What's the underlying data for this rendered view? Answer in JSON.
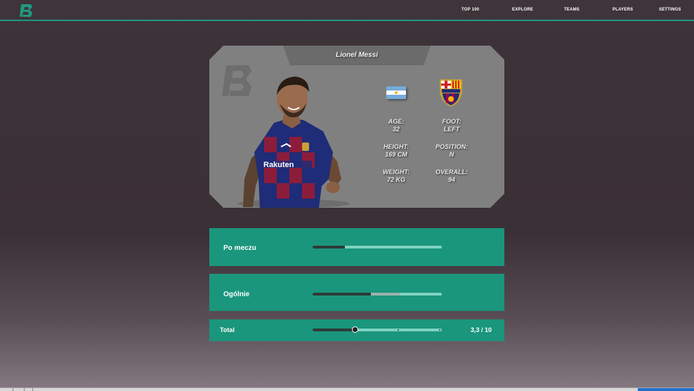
{
  "nav": {
    "items": [
      "TOP 100",
      "EXPLORE",
      "TEAMS",
      "PLAYERS",
      "SETTINGS"
    ]
  },
  "player": {
    "name": "Lionel Messi",
    "nationality_flag": "argentina-flag-icon",
    "club_crest": "fc-barcelona-crest-icon",
    "stats": {
      "age_label": "AGE:",
      "age_value": "32",
      "foot_label": "FOOT:",
      "foot_value": "LEFT",
      "height_label": "HEIGHT:",
      "height_value": "169 CM",
      "position_label": "POSITION:",
      "position_value": "N",
      "weight_label": "WEIGHT:",
      "weight_value": "72 KG",
      "overall_label": "OVERALL:",
      "overall_value": "94"
    }
  },
  "ratings": {
    "po_meczu": {
      "label": "Po meczu",
      "fill_fraction": 0.25
    },
    "ogolnie": {
      "label": "Ogólnie",
      "fill_fraction": 0.45,
      "mid_fraction": 0.68
    },
    "total": {
      "label": "Total",
      "value_text": "3,3 / 10",
      "value": 3.3,
      "max": 10
    }
  },
  "colors": {
    "accent": "#1a967c",
    "background": "#3d3339",
    "card": "#808080"
  }
}
